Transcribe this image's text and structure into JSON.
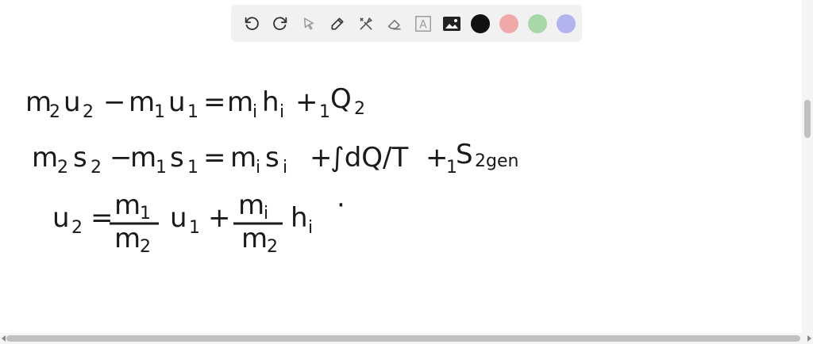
{
  "toolbar": {
    "tools": [
      {
        "icon": "undo-icon"
      },
      {
        "icon": "redo-icon"
      },
      {
        "icon": "pointer-icon"
      },
      {
        "icon": "pen-icon"
      },
      {
        "icon": "tools-icon"
      },
      {
        "icon": "eraser-icon"
      },
      {
        "icon": "text-box-icon"
      },
      {
        "icon": "image-icon"
      }
    ],
    "text_tool_glyph": "A",
    "colors": [
      "#111111",
      "#f1a8a8",
      "#a8d8a8",
      "#b3b3f0"
    ]
  },
  "whiteboard": {
    "line1": {
      "a": "m",
      "a_sub": "2",
      "b": "u",
      "b_sub": "2",
      "minus": "−",
      "c": "m",
      "c_sub": "1",
      "d": "u",
      "d_sub": "1",
      "eq": "=",
      "e": "m",
      "e_sub": "i",
      "f": "h",
      "f_sub": "i",
      "plus": "+",
      "g_pre": "1",
      "g": "Q",
      "g_sub": "2"
    },
    "line2": {
      "a": "m",
      "a_sub": "2",
      "b": "s",
      "b_sub": "2",
      "minus": "−",
      "c": "m",
      "c_sub": "1",
      "d": "s",
      "d_sub": "1",
      "eq": "=",
      "e": "m",
      "e_sub": "i",
      "f": "s",
      "f_sub": "i",
      "plus": "+",
      "integral": "∫dQ/T",
      "plus2": "+",
      "g_pre": "1",
      "g": "S",
      "g_sub": "2gen"
    },
    "line3": {
      "lhs": "u",
      "lhs_sub": "2",
      "eq": "=",
      "f1_num": "m",
      "f1_num_sub": "1",
      "f1_den": "m",
      "f1_den_sub": "2",
      "t1": "u",
      "t1_sub": "1",
      "plus": "+",
      "f2_num": "m",
      "f2_num_sub": "i",
      "f2_den": "m",
      "f2_den_sub": "2",
      "t2": "h",
      "t2_sub": "i",
      "dot": "·"
    }
  }
}
